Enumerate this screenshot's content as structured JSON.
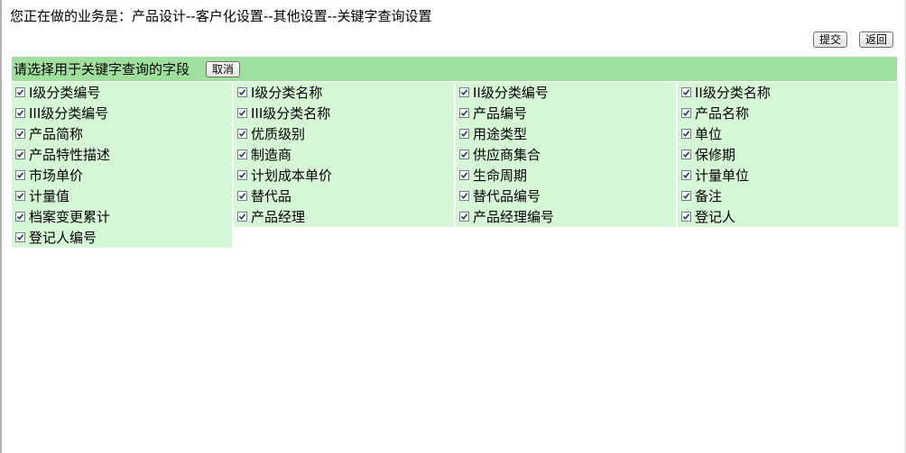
{
  "business_line": "您正在做的业务是：产品设计--客户化设置--其他设置--关键字查询设置",
  "toolbar": {
    "submit_label": "提交",
    "back_label": "返回"
  },
  "panel": {
    "title": "请选择用于关键字查询的字段",
    "cancel_label": "取消"
  },
  "fields": [
    {
      "label": "I级分类编号",
      "checked": true
    },
    {
      "label": "I级分类名称",
      "checked": true
    },
    {
      "label": "II级分类编号",
      "checked": true
    },
    {
      "label": "II级分类名称",
      "checked": true
    },
    {
      "label": "III级分类编号",
      "checked": true
    },
    {
      "label": "III级分类名称",
      "checked": true
    },
    {
      "label": "产品编号",
      "checked": true
    },
    {
      "label": "产品名称",
      "checked": true
    },
    {
      "label": "产品简称",
      "checked": true
    },
    {
      "label": "优质级别",
      "checked": true
    },
    {
      "label": "用途类型",
      "checked": true
    },
    {
      "label": "单位",
      "checked": true
    },
    {
      "label": "产品特性描述",
      "checked": true
    },
    {
      "label": "制造商",
      "checked": true
    },
    {
      "label": "供应商集合",
      "checked": true
    },
    {
      "label": "保修期",
      "checked": true
    },
    {
      "label": "市场单价",
      "checked": true
    },
    {
      "label": "计划成本单价",
      "checked": true
    },
    {
      "label": "生命周期",
      "checked": true
    },
    {
      "label": "计量单位",
      "checked": true
    },
    {
      "label": "计量值",
      "checked": true
    },
    {
      "label": "替代品",
      "checked": true
    },
    {
      "label": "替代品编号",
      "checked": true
    },
    {
      "label": "备注",
      "checked": true
    },
    {
      "label": "档案变更累计",
      "checked": true
    },
    {
      "label": "产品经理",
      "checked": true
    },
    {
      "label": "产品经理编号",
      "checked": true
    },
    {
      "label": "登记人",
      "checked": true
    },
    {
      "label": "登记人编号",
      "checked": true
    }
  ],
  "colors": {
    "header_bg": "#9fe09f",
    "cell_bg": "#d6f7d6"
  }
}
